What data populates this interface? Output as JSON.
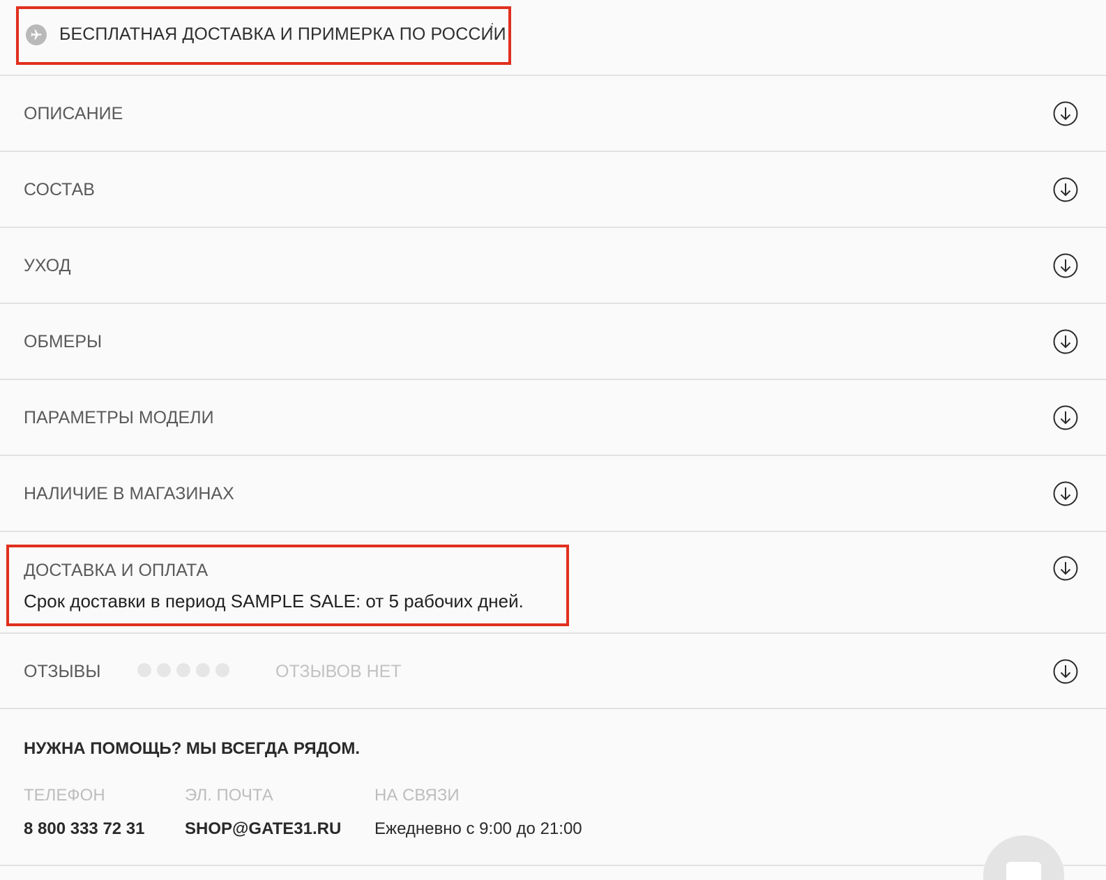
{
  "shipping": {
    "text": "БЕСПЛАТНАЯ ДОСТАВКА И ПРИМЕРКА ПО РОССИИ",
    "info_mark": "i",
    "icon": "plane-icon"
  },
  "accordion": {
    "items": [
      {
        "label": "ОПИСАНИЕ",
        "icon": "arrow-down-circle-icon"
      },
      {
        "label": "СОСТАВ",
        "icon": "arrow-down-circle-icon"
      },
      {
        "label": "УХОД",
        "icon": "arrow-down-circle-icon"
      },
      {
        "label": "ОБМЕРЫ",
        "icon": "arrow-down-circle-icon"
      },
      {
        "label": "ПАРАМЕТРЫ МОДЕЛИ",
        "icon": "arrow-down-circle-icon"
      },
      {
        "label": "НАЛИЧИЕ В МАГАЗИНАХ",
        "icon": "arrow-down-circle-icon"
      }
    ],
    "delivery": {
      "label": "ДОСТАВКА И ОПЛАТА",
      "text": "Срок доставки в период SAMPLE SALE: от 5 рабочих дней.",
      "icon": "arrow-down-circle-icon"
    },
    "reviews": {
      "label": "ОТЗЫВЫ",
      "rating": 0,
      "rating_max": 5,
      "status": "ОТЗЫВОВ НЕТ",
      "icon": "arrow-down-circle-icon"
    }
  },
  "help": {
    "title": "НУЖНА ПОМОЩЬ? МЫ ВСЕГДА РЯДОМ.",
    "phone": {
      "label": "ТЕЛЕФОН",
      "value": "8 800 333 72 31"
    },
    "email": {
      "label": "ЭЛ. ПОЧТА",
      "value": "SHOP@GATE31.RU"
    },
    "hours": {
      "label": "НА СВЯЗИ",
      "value": "Ежедневно с 9:00 до 21:00"
    }
  },
  "colors": {
    "highlight": "#e0301e",
    "divider": "#e2e2e2",
    "background": "#fafafa"
  }
}
